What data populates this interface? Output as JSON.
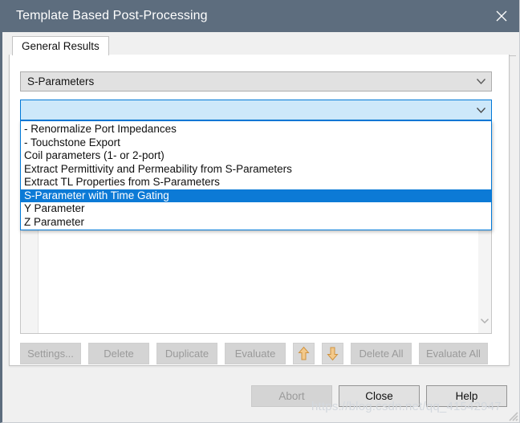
{
  "window": {
    "title": "Template Based Post-Processing",
    "close_icon": "close-icon",
    "titlebar_color": "#5d6d7e"
  },
  "tabs": [
    {
      "label": "General Results",
      "active": true
    }
  ],
  "category_combo": {
    "value": "S-Parameters",
    "chevron_icon": "chevron-down-icon"
  },
  "template_combo": {
    "value": "",
    "placeholder": "",
    "chevron_icon": "chevron-down-icon",
    "open": true,
    "highlight_color": "#cde8fa",
    "focus_border": "#0078d7"
  },
  "dropdown": {
    "selected_index": 5,
    "selection_color": "#0c7ad6",
    "items": [
      "- Renormalize Port Impedances",
      "- Touchstone Export",
      "Coil parameters (1- or 2-port)",
      "Extract Permittivity and Permeability from S-Parameters",
      "Extract TL Properties from S-Parameters",
      "S-Parameter with Time Gating",
      "Y Parameter",
      "Z Parameter"
    ]
  },
  "result_list": {
    "rows": [],
    "scrollbar_icon": "chevron-down-icon"
  },
  "toolbar": {
    "buttons": [
      {
        "label": "Settings...",
        "enabled": false
      },
      {
        "label": "Delete",
        "enabled": false
      },
      {
        "label": "Duplicate",
        "enabled": false
      },
      {
        "label": "Evaluate",
        "enabled": false
      }
    ],
    "move_up": {
      "icon": "arrow-up-icon",
      "color": "#e8a33d"
    },
    "move_down": {
      "icon": "arrow-down-icon",
      "color": "#e8a33d"
    },
    "buttons_right": [
      {
        "label": "Delete All",
        "enabled": false
      },
      {
        "label": "Evaluate All",
        "enabled": false
      }
    ]
  },
  "footer": {
    "abort": {
      "label": "Abort",
      "enabled": false
    },
    "close": {
      "label": "Close",
      "enabled": true
    },
    "help": {
      "label": "Help",
      "enabled": true
    }
  },
  "watermark": {
    "text": "https://blog.csdn.net/qq_41542947"
  }
}
